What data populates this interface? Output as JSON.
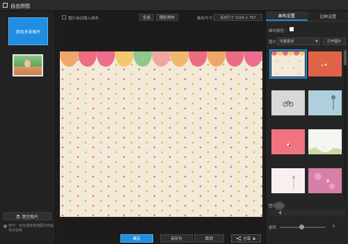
{
  "app": {
    "title": "自由拼图"
  },
  "left": {
    "add_button": "添加多张图片",
    "clear_button": "清空图片",
    "tip": "技巧：双击或者拖拽图片到画布可替换"
  },
  "toolbar": {
    "auto_fill_label": "图片自动填入画布",
    "select_all": "全选",
    "random_sort": "随机排布",
    "size_label": "画布尺寸：",
    "size_value": "素材尺寸 1024 × 767"
  },
  "bottom": {
    "confirm": "确定",
    "save_as": "另存为",
    "cancel": "取消",
    "share": "分享"
  },
  "right": {
    "tabs": [
      {
        "label": "画布设置"
      },
      {
        "label": "边框设置"
      }
    ],
    "bg_color_label": "画布颜色：",
    "bg_color": "#ffffff",
    "image_label": "图片：",
    "image_select": "内置素材",
    "open_button": "打开图片",
    "ops_label": "图片操作：",
    "rotate_label": "旋转",
    "rotate_value": "0"
  },
  "colors": {
    "accent": "#1f8de0",
    "scallop_colors": [
      "#f0a66a",
      "#ec6d82",
      "#ed6d8f",
      "#f3c96e",
      "#91c78d",
      "#eea8a0",
      "#f0b66c",
      "#ec6d82"
    ]
  },
  "templates": [
    {
      "name": "polka-dot-scallop",
      "selected": true
    },
    {
      "name": "orange-solid",
      "selected": false
    },
    {
      "name": "gray-bicycle",
      "selected": false
    },
    {
      "name": "light-blue-tree",
      "selected": false
    },
    {
      "name": "pink-coral",
      "selected": false
    },
    {
      "name": "white-grass",
      "selected": false
    },
    {
      "name": "pink-white-flower",
      "selected": false
    },
    {
      "name": "pink-pattern",
      "selected": false
    }
  ]
}
